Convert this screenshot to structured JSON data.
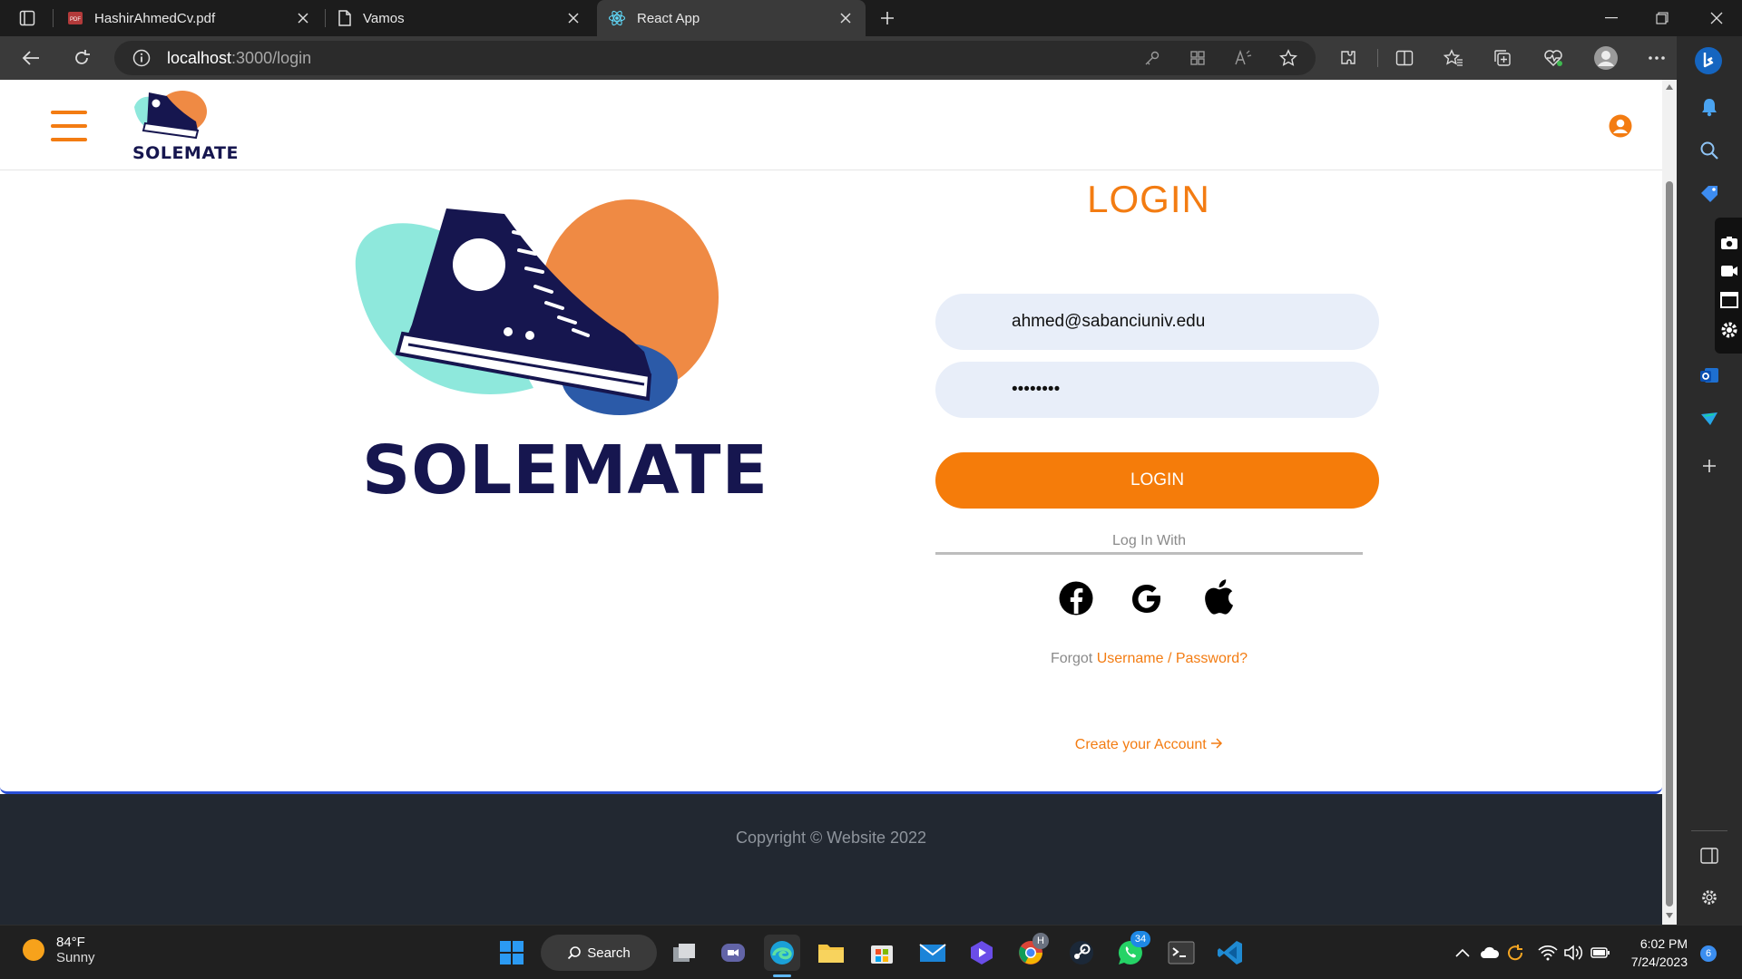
{
  "browser": {
    "tabs": [
      {
        "label": "HashirAhmedCv.pdf",
        "icon": "pdf-icon",
        "active": false
      },
      {
        "label": "Vamos",
        "icon": "page-icon",
        "active": false
      },
      {
        "label": "React App",
        "icon": "react-icon",
        "active": true
      }
    ],
    "url_host": "localhost",
    "url_path": ":3000/login"
  },
  "site": {
    "brand": "SOLEMATE",
    "login_title": "LOGIN",
    "email_value": "ahmed@sabanciuniv.edu",
    "password_value": "••••••••",
    "login_button": "LOGIN",
    "login_with": "Log In With",
    "forgot_prefix": "Forgot",
    "forgot_link": "Username / Password?",
    "create_account": "Create your Account",
    "copyright": "Copyright © Website 2022",
    "colors": {
      "accent": "#f57c0a",
      "navy": "#16164f",
      "teal": "#8ee8dc",
      "footer": "#222831"
    }
  },
  "taskbar": {
    "temperature": "84°F",
    "condition": "Sunny",
    "search_label": "Search",
    "time": "6:02 PM",
    "date": "7/24/2023",
    "whatsapp_badge": "34",
    "notification_count": "6",
    "chrome_badge": "H"
  }
}
